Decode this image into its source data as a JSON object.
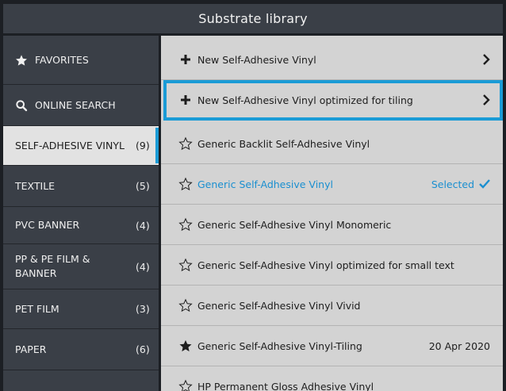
{
  "header": {
    "title": "Substrate library"
  },
  "sidebar": {
    "items": [
      {
        "label": "FAVORITES",
        "count": "",
        "icon": "star-icon"
      },
      {
        "label": "ONLINE SEARCH",
        "count": "",
        "icon": "search-icon"
      },
      {
        "label": "SELF-ADHESIVE VINYL",
        "count": "(9)",
        "icon": ""
      },
      {
        "label": "TEXTILE",
        "count": "(5)",
        "icon": ""
      },
      {
        "label": "PVC BANNER",
        "count": "(4)",
        "icon": ""
      },
      {
        "label": "PP & PE FILM & BANNER",
        "count": "(4)",
        "icon": ""
      },
      {
        "label": "PET FILM",
        "count": "(3)",
        "icon": ""
      },
      {
        "label": "PAPER",
        "count": "(6)",
        "icon": ""
      }
    ]
  },
  "list": {
    "items": [
      {
        "label": "New Self-Adhesive Vinyl",
        "icon": "plus-icon",
        "right": ""
      },
      {
        "label": "New Self-Adhesive Vinyl optimized for tiling",
        "icon": "plus-icon",
        "right": ""
      },
      {
        "label": "Generic Backlit Self-Adhesive Vinyl",
        "icon": "star-outline-icon",
        "right": ""
      },
      {
        "label": "Generic Self-Adhesive Vinyl",
        "icon": "star-outline-icon",
        "right": "Selected"
      },
      {
        "label": "Generic Self-Adhesive Vinyl Monomeric",
        "icon": "star-outline-icon",
        "right": ""
      },
      {
        "label": "Generic Self-Adhesive Vinyl optimized for small text",
        "icon": "star-outline-icon",
        "right": ""
      },
      {
        "label": "Generic Self-Adhesive Vinyl Vivid",
        "icon": "star-outline-icon",
        "right": ""
      },
      {
        "label": "Generic Self-Adhesive Vinyl-Tiling",
        "icon": "star-filled-icon",
        "right": "20 Apr 2020"
      },
      {
        "label": "HP Permanent Gloss Adhesive Vinyl",
        "icon": "star-outline-icon",
        "right": ""
      }
    ]
  },
  "colors": {
    "accent": "#1a9bd6",
    "sidebar": "#3a3f47",
    "content": "#d3d3d3"
  }
}
